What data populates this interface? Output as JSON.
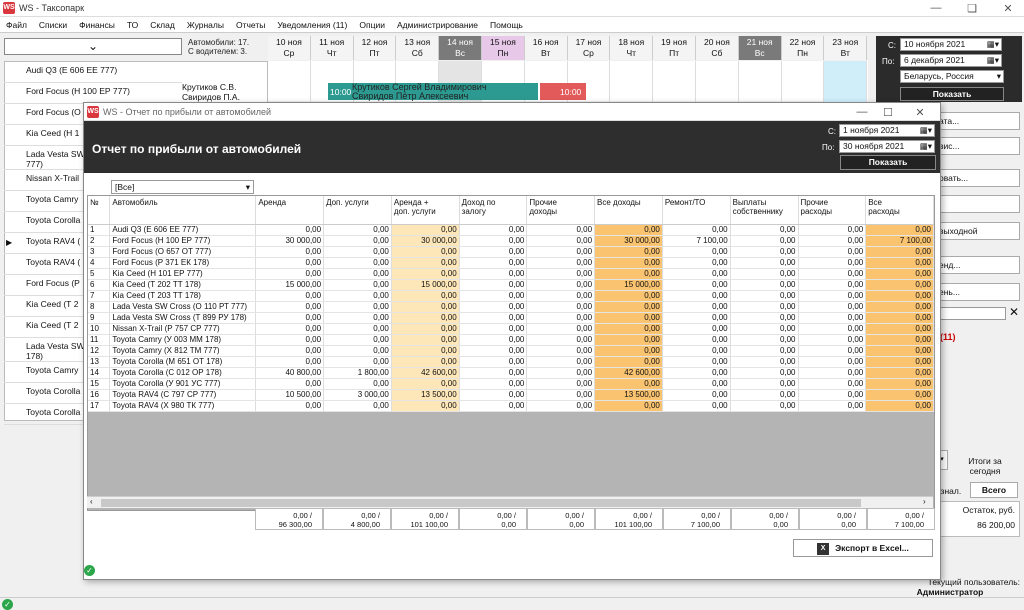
{
  "app": {
    "title": "WS - Таксопарк",
    "icon": "WS"
  },
  "menu": [
    "Файл",
    "Списки",
    "Финансы",
    "ТО",
    "Склад",
    "Журналы",
    "Отчеты",
    "Уведомления (11)",
    "Опции",
    "Администрирование",
    "Помощь"
  ],
  "schedule": {
    "car_count_line1": "Автомобили: 17.",
    "car_count_line2": "С водителем: 3.",
    "dates": [
      {
        "d": "10 ноя",
        "w": "Ср"
      },
      {
        "d": "11 ноя",
        "w": "Чт"
      },
      {
        "d": "12 ноя",
        "w": "Пт"
      },
      {
        "d": "13 ноя",
        "w": "Сб"
      },
      {
        "d": "14 ноя",
        "w": "Вс"
      },
      {
        "d": "15 ноя",
        "w": "Пн"
      },
      {
        "d": "16 ноя",
        "w": "Вт"
      },
      {
        "d": "17 ноя",
        "w": "Ср"
      },
      {
        "d": "18 ноя",
        "w": "Чт"
      },
      {
        "d": "19 ноя",
        "w": "Пт"
      },
      {
        "d": "20 ноя",
        "w": "Сб"
      },
      {
        "d": "21 ноя",
        "w": "Вс"
      },
      {
        "d": "22 ноя",
        "w": "Пн"
      },
      {
        "d": "23 ноя",
        "w": "Вт"
      }
    ],
    "cars": [
      "Audi Q3 (Е 606 ЕЕ 777)",
      "Ford Focus (Н 100 ЕР 777)",
      "Ford Focus (О",
      "Kia Ceed (Н 1",
      "Lada Vesta SW\n777)",
      "Nissan X-Trail",
      "Toyota Camry",
      "Toyota Corolla",
      "Toyota RAV4 (",
      "Toyota RAV4 (",
      "Ford Focus (Р",
      "Kia Ceed (Т 2",
      "Kia Ceed (Т 2",
      "Lada Vesta SW\n178)",
      "Toyota Camry",
      "Toyota Corolla",
      "Toyota Corolla"
    ],
    "drivers_line1": "Крутиков С.В.",
    "drivers_line2": "Свиридов П.А.",
    "booking_name1": "Крутиков Сергей Владимирович",
    "booking_name2": "Свиридов Пётр Алексеевич",
    "booking_start": "10:00",
    "booking_end": "10:00"
  },
  "right_panel": {
    "from_label": "С:",
    "to_label": "По:",
    "from_date": "10 ноября 2021",
    "to_date": "6 декабря 2021",
    "region": "Беларусь, Россия",
    "show_button": "Показать",
    "side_buttons": [
      "ата...",
      "вис...",
      "овать...",
      "",
      "выходной",
      "енд...",
      "ень..."
    ],
    "notifications_suffix": "(11)",
    "totals_label": "Итоги за сегодня",
    "tab_a": "езнал.",
    "tab_b": "Всего",
    "balance_label": "Остаток, руб.",
    "balance_value": "86 200,00",
    "current_user_label": "Текущий пользователь:",
    "current_user": "Администратор"
  },
  "dialog": {
    "window_title": "WS - Отчет по прибыли от автомобилей",
    "heading": "Отчет по прибыли от автомобилей",
    "from_label": "С:",
    "to_label": "По:",
    "from_date": "1 ноября 2021",
    "to_date": "30 ноября 2021",
    "show_button": "Показать",
    "filter_value": "[Все]",
    "export_button": "Экспорт в Excel...",
    "columns": [
      "№",
      "Автомобиль",
      "Аренда",
      "Доп. услуги",
      "Аренда +\nдоп. услуги",
      "Доход по\nзалогу",
      "Прочие\nдоходы",
      "Все доходы",
      "Ремонт/ТО",
      "Выплаты\nсобственнику",
      "Прочие\nрасходы",
      "Все\nрасходы"
    ],
    "rows": [
      [
        "1",
        "Audi Q3 (Е 606 ЕЕ 777)",
        "0,00",
        "0,00",
        "0,00",
        "0,00",
        "0,00",
        "0,00",
        "0,00",
        "0,00",
        "0,00",
        "0,00"
      ],
      [
        "2",
        "Ford Focus (Н 100 ЕР 777)",
        "30 000,00",
        "0,00",
        "30 000,00",
        "0,00",
        "0,00",
        "30 000,00",
        "7 100,00",
        "0,00",
        "0,00",
        "7 100,00"
      ],
      [
        "3",
        "Ford Focus (О 657 ОТ 777)",
        "0,00",
        "0,00",
        "0,00",
        "0,00",
        "0,00",
        "0,00",
        "0,00",
        "0,00",
        "0,00",
        "0,00"
      ],
      [
        "4",
        "Ford Focus (Р 371 ЕК 178)",
        "0,00",
        "0,00",
        "0,00",
        "0,00",
        "0,00",
        "0,00",
        "0,00",
        "0,00",
        "0,00",
        "0,00"
      ],
      [
        "5",
        "Kia Ceed (Н 101 ЕР 777)",
        "0,00",
        "0,00",
        "0,00",
        "0,00",
        "0,00",
        "0,00",
        "0,00",
        "0,00",
        "0,00",
        "0,00"
      ],
      [
        "6",
        "Kia Ceed (Т 202 ТТ 178)",
        "15 000,00",
        "0,00",
        "15 000,00",
        "0,00",
        "0,00",
        "15 000,00",
        "0,00",
        "0,00",
        "0,00",
        "0,00"
      ],
      [
        "7",
        "Kia Ceed (Т 203 ТТ 178)",
        "0,00",
        "0,00",
        "0,00",
        "0,00",
        "0,00",
        "0,00",
        "0,00",
        "0,00",
        "0,00",
        "0,00"
      ],
      [
        "8",
        "Lada Vesta SW Cross (О 110 РТ 777)",
        "0,00",
        "0,00",
        "0,00",
        "0,00",
        "0,00",
        "0,00",
        "0,00",
        "0,00",
        "0,00",
        "0,00"
      ],
      [
        "9",
        "Lada Vesta SW Cross (Т 899 РУ 178)",
        "0,00",
        "0,00",
        "0,00",
        "0,00",
        "0,00",
        "0,00",
        "0,00",
        "0,00",
        "0,00",
        "0,00"
      ],
      [
        "10",
        "Nissan X-Trail (Р 757 СР 777)",
        "0,00",
        "0,00",
        "0,00",
        "0,00",
        "0,00",
        "0,00",
        "0,00",
        "0,00",
        "0,00",
        "0,00"
      ],
      [
        "11",
        "Toyota Camry (У 003 ММ 178)",
        "0,00",
        "0,00",
        "0,00",
        "0,00",
        "0,00",
        "0,00",
        "0,00",
        "0,00",
        "0,00",
        "0,00"
      ],
      [
        "12",
        "Toyota Camry (Х 812 ТМ 777)",
        "0,00",
        "0,00",
        "0,00",
        "0,00",
        "0,00",
        "0,00",
        "0,00",
        "0,00",
        "0,00",
        "0,00"
      ],
      [
        "13",
        "Toyota Corolla (М 651 ОТ 178)",
        "0,00",
        "0,00",
        "0,00",
        "0,00",
        "0,00",
        "0,00",
        "0,00",
        "0,00",
        "0,00",
        "0,00"
      ],
      [
        "14",
        "Toyota Corolla (С 012 ОР 178)",
        "40 800,00",
        "1 800,00",
        "42 600,00",
        "0,00",
        "0,00",
        "42 600,00",
        "0,00",
        "0,00",
        "0,00",
        "0,00"
      ],
      [
        "15",
        "Toyota Corolla (У 901 УС 777)",
        "0,00",
        "0,00",
        "0,00",
        "0,00",
        "0,00",
        "0,00",
        "0,00",
        "0,00",
        "0,00",
        "0,00"
      ],
      [
        "16",
        "Toyota RAV4 (С 797 СР 777)",
        "10 500,00",
        "3 000,00",
        "13 500,00",
        "0,00",
        "0,00",
        "13 500,00",
        "0,00",
        "0,00",
        "0,00",
        "0,00"
      ],
      [
        "17",
        "Toyota RAV4 (Х 980 ТК 777)",
        "0,00",
        "0,00",
        "0,00",
        "0,00",
        "0,00",
        "0,00",
        "0,00",
        "0,00",
        "0,00",
        "0,00"
      ]
    ],
    "totals": [
      [
        "0,00 /",
        "96 300,00"
      ],
      [
        "0,00 /",
        "4 800,00"
      ],
      [
        "0,00 /",
        "101 100,00"
      ],
      [
        "0,00 /",
        "0,00"
      ],
      [
        "0,00 /",
        "0,00"
      ],
      [
        "0,00 /",
        "101 100,00"
      ],
      [
        "0,00 /",
        "7 100,00"
      ],
      [
        "0,00 /",
        "0,00"
      ],
      [
        "0,00 /",
        "0,00"
      ],
      [
        "0,00 /",
        "7 100,00"
      ]
    ]
  },
  "colors": {
    "header_dark": "#2e2e2e",
    "highlight_yellow": "#fde6b8",
    "highlight_orange": "#f9c370",
    "booking_green": "#2d9a91",
    "booking_red": "#e25a5a"
  },
  "icons": [
    "app-logo-icon",
    "minimize-icon",
    "restore-icon",
    "close-icon",
    "chevron-down-icon",
    "calendar-icon",
    "excel-icon",
    "ok-status-icon"
  ]
}
